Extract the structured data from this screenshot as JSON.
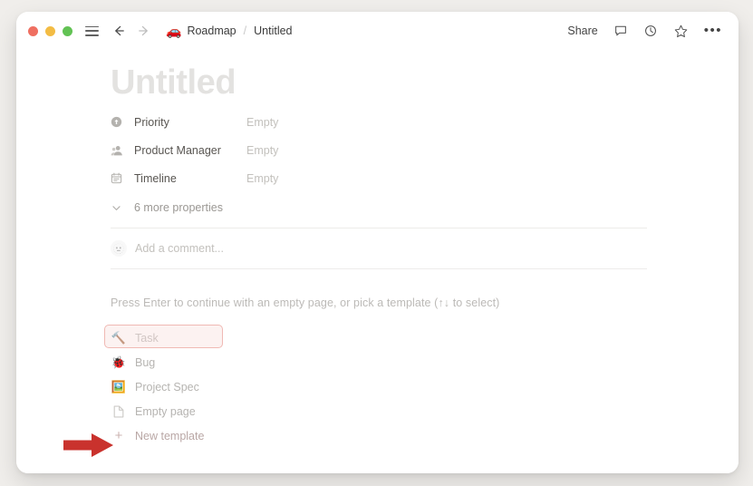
{
  "window": {
    "traffic_lights": [
      "close",
      "minimize",
      "maximize"
    ],
    "colors": {
      "close": "#ef6f61",
      "minimize": "#f3bc44",
      "maximize": "#62c254",
      "accent_red": "#c9322d",
      "highlight_border": "#f0b9b4",
      "highlight_fill": "#f9e1de",
      "background": "#f0eeeb"
    }
  },
  "titlebar": {
    "menu_icon": "hamburger-icon",
    "back_icon": "←",
    "forward_icon": "→",
    "breadcrumb": {
      "parent_emoji": "🚗",
      "parent": "Roadmap",
      "separator": "/",
      "current": "Untitled"
    },
    "share_label": "Share",
    "comment_icon": "comment-icon",
    "history_icon": "clock-icon",
    "favorite_icon": "star-icon",
    "more_icon": "•••"
  },
  "document": {
    "title_placeholder": "Untitled",
    "properties": [
      {
        "icon": "priority-icon",
        "label": "Priority",
        "value": "Empty"
      },
      {
        "icon": "person-icon",
        "label": "Product Manager",
        "value": "Empty"
      },
      {
        "icon": "calendar-icon",
        "label": "Timeline",
        "value": "Empty"
      }
    ],
    "more_properties_label": "6 more properties",
    "more_properties_chevron": "chevron-down-icon",
    "comment": {
      "avatar_emoji": "🫥",
      "placeholder": "Add a comment..."
    }
  },
  "template_picker": {
    "hint": "Press Enter to continue with an empty page, or pick a template (↑↓ to select)",
    "items": [
      {
        "emoji": "🔨",
        "label": "Task",
        "icon_name": "hammer-emoji"
      },
      {
        "emoji": "🐞",
        "label": "Bug",
        "icon_name": "ladybug-emoji"
      },
      {
        "emoji": "🖼️",
        "label": "Project Spec",
        "icon_name": "framed-picture-emoji"
      },
      {
        "emoji": "📄",
        "label": "Empty page",
        "icon_name": "page-icon"
      },
      {
        "emoji": "+",
        "label": "New template",
        "icon_name": "plus-icon"
      }
    ],
    "highlighted_item": "New template"
  },
  "annotation": {
    "arrow": "red-right-arrow",
    "points_to": "New template"
  }
}
